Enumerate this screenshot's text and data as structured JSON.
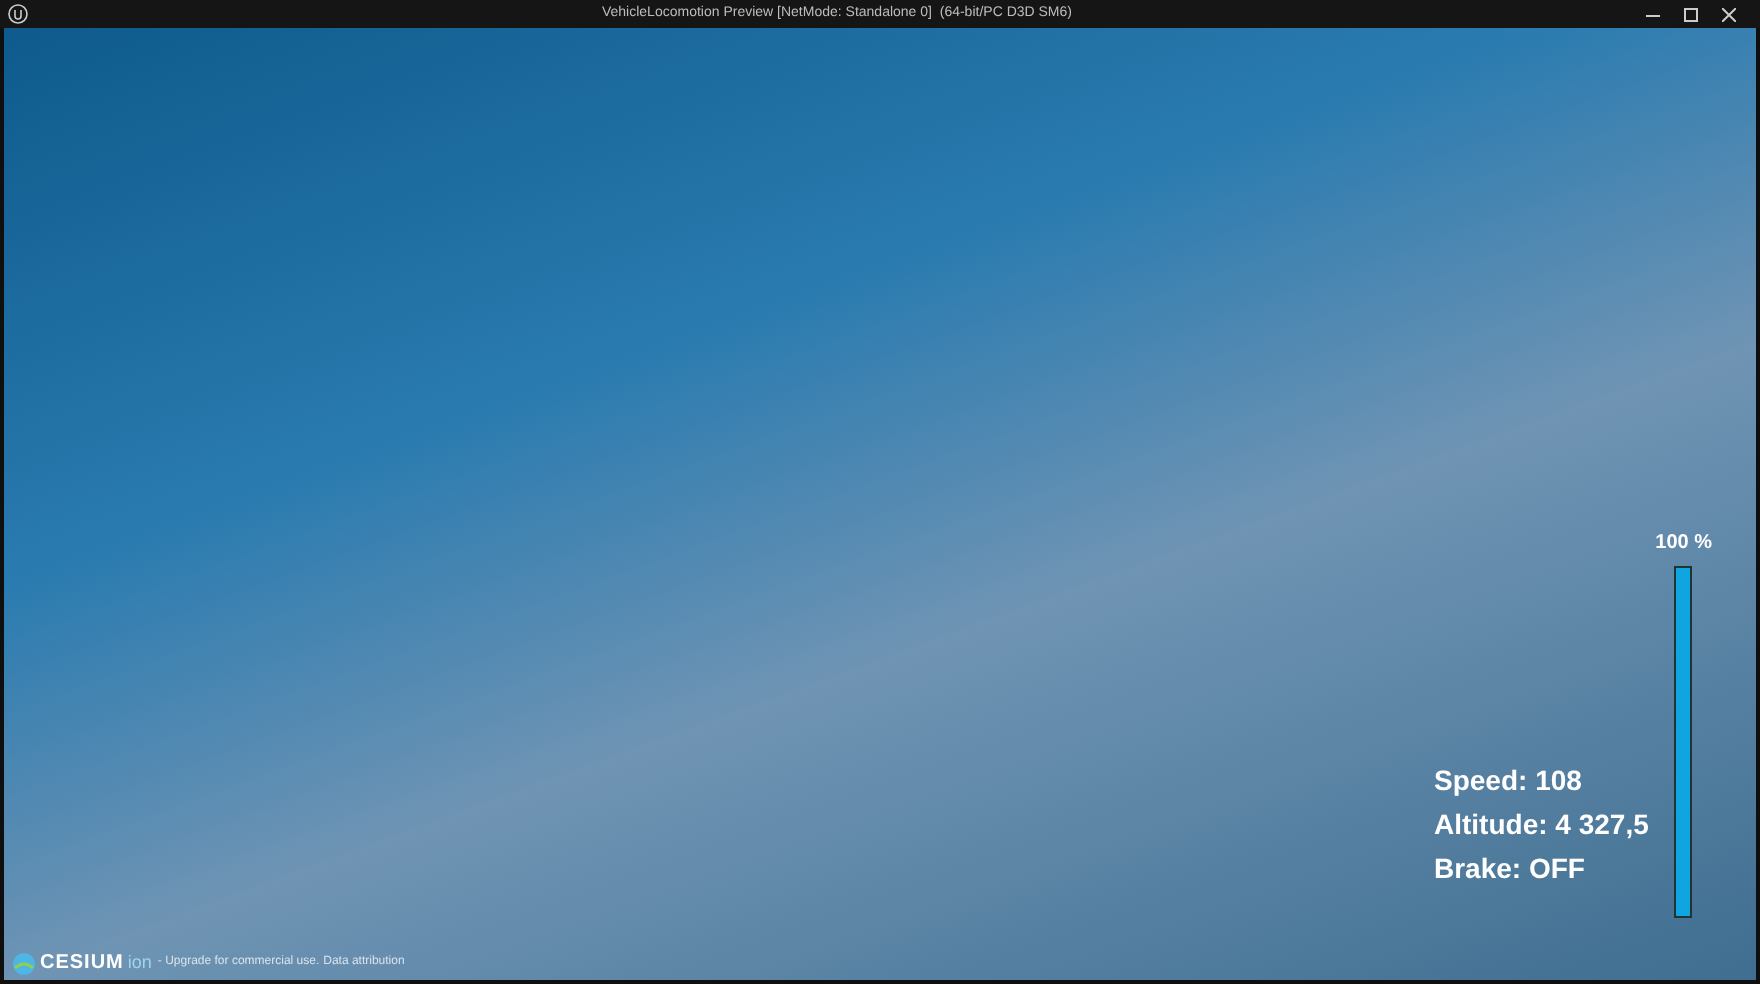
{
  "window": {
    "title": "VehicleLocomotion Preview [NetMode: Standalone 0]  (64-bit/PC D3D SM6)"
  },
  "hud": {
    "throttle": {
      "label": "100 %",
      "level": 1.0
    },
    "readouts": [
      {
        "text": "Speed: 108"
      },
      {
        "text": "Altitude: 4 327,5"
      },
      {
        "text": "Brake: OFF"
      }
    ]
  },
  "credits": {
    "logo_text": "CESIUM",
    "logo_suffix": "ion",
    "message": "- Upgrade for commercial use.",
    "link": "Data attribution"
  }
}
